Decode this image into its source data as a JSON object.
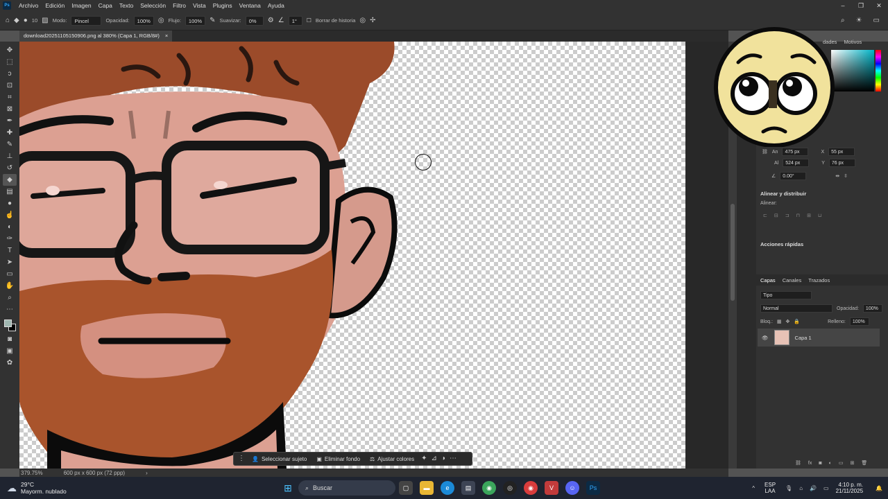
{
  "menu": {
    "items": [
      "Archivo",
      "Edición",
      "Imagen",
      "Capa",
      "Texto",
      "Selección",
      "Filtro",
      "Vista",
      "Plugins",
      "Ventana",
      "Ayuda"
    ]
  },
  "options": {
    "brush_size": "10",
    "modo_label": "Modo:",
    "modo_value": "Pincel",
    "opacidad_label": "Opacidad:",
    "opacidad_value": "100%",
    "flujo_label": "Flujo:",
    "flujo_value": "100%",
    "suavizar_label": "Suavizar:",
    "suavizar_value": "0%",
    "angle_value": "1°",
    "borrar_historia": "Borrar de historia"
  },
  "document": {
    "tab_title": "download20251105150906.png al 380% (Capa 1, RGB/8#)",
    "close": "×"
  },
  "status": {
    "zoom": "379.75%",
    "doc_info": "600 px x 600 px (72 ppp)"
  },
  "context_bar": {
    "select_subject": "Seleccionar sujeto",
    "remove_bg": "Eliminar fondo",
    "adjust_colors": "Ajustar colores"
  },
  "panels": {
    "top_tabs": [
      "dades",
      "Motivos"
    ],
    "transform": {
      "an_label": "An",
      "an_value": "475 px",
      "x_label": "X",
      "x_value": "55 px",
      "al_label": "Al",
      "al_value": "524 px",
      "y_label": "Y",
      "y_value": "76 px",
      "angle_value": "0.00°"
    },
    "align_title": "Alinear y distribuir",
    "align_label": "Alinear:",
    "quick_title": "Acciones rápidas",
    "layers_tabs": [
      "Capas",
      "Canales",
      "Trazados"
    ],
    "filter_kind": "Tipo",
    "blend_mode": "Normal",
    "layer_opacity_label": "Opacidad:",
    "layer_opacity_value": "100%",
    "lock_label": "Bloq.:",
    "fill_label": "Relleno:",
    "fill_value": "100%",
    "layer_name": "Capa 1"
  },
  "taskbar": {
    "temperature": "29°C",
    "weather": "Mayorm. nublado",
    "search": "Buscar",
    "lang1": "ESP",
    "lang2": "LAA",
    "time": "4:10 p. m.",
    "date": "21/11/2025"
  },
  "colors": {
    "foreground": "#9fb7b0",
    "background": "#000000",
    "accent_blue": "#31a8ff"
  }
}
